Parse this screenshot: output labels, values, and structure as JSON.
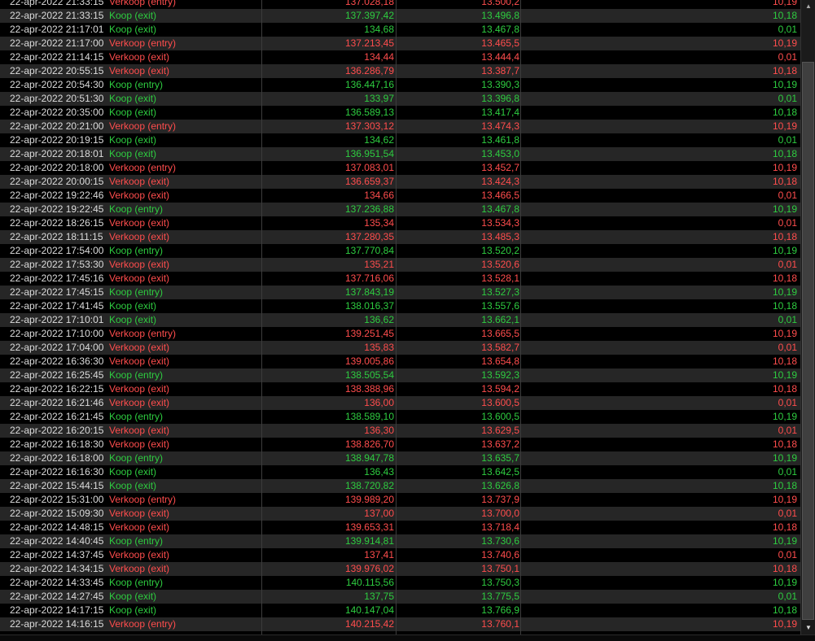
{
  "colors": {
    "buy": "#2ecc40",
    "sell": "#ff4d4d",
    "date": "#dcdcdc"
  },
  "rows": [
    {
      "datetime": "22-apr-2022 21:33:15",
      "type": "Verkoop (entry)",
      "side": "sell",
      "price": "137.028,18",
      "rate": "13.500,2",
      "amount": "10,19"
    },
    {
      "datetime": "22-apr-2022 21:33:15",
      "type": "Koop (exit)",
      "side": "buy",
      "price": "137.397,42",
      "rate": "13.496,8",
      "amount": "10,18"
    },
    {
      "datetime": "22-apr-2022 21:17:01",
      "type": "Koop (exit)",
      "side": "buy",
      "price": "134,68",
      "rate": "13.467,8",
      "amount": "0,01"
    },
    {
      "datetime": "22-apr-2022 21:17:00",
      "type": "Verkoop (entry)",
      "side": "sell",
      "price": "137.213,45",
      "rate": "13.465,5",
      "amount": "10,19"
    },
    {
      "datetime": "22-apr-2022 21:14:15",
      "type": "Verkoop (exit)",
      "side": "sell",
      "price": "134,44",
      "rate": "13.444,4",
      "amount": "0,01"
    },
    {
      "datetime": "22-apr-2022 20:55:15",
      "type": "Verkoop (exit)",
      "side": "sell",
      "price": "136.286,79",
      "rate": "13.387,7",
      "amount": "10,18"
    },
    {
      "datetime": "22-apr-2022 20:54:30",
      "type": "Koop (entry)",
      "side": "buy",
      "price": "136.447,16",
      "rate": "13.390,3",
      "amount": "10,19"
    },
    {
      "datetime": "22-apr-2022 20:51:30",
      "type": "Koop (exit)",
      "side": "buy",
      "price": "133,97",
      "rate": "13.396,8",
      "amount": "0,01"
    },
    {
      "datetime": "22-apr-2022 20:35:00",
      "type": "Koop (exit)",
      "side": "buy",
      "price": "136.589,13",
      "rate": "13.417,4",
      "amount": "10,18"
    },
    {
      "datetime": "22-apr-2022 20:21:00",
      "type": "Verkoop (entry)",
      "side": "sell",
      "price": "137.303,12",
      "rate": "13.474,3",
      "amount": "10,19"
    },
    {
      "datetime": "22-apr-2022 20:19:15",
      "type": "Koop (exit)",
      "side": "buy",
      "price": "134,62",
      "rate": "13.461,8",
      "amount": "0,01"
    },
    {
      "datetime": "22-apr-2022 20:18:01",
      "type": "Koop (exit)",
      "side": "buy",
      "price": "136.951,54",
      "rate": "13.453,0",
      "amount": "10,18"
    },
    {
      "datetime": "22-apr-2022 20:18:00",
      "type": "Verkoop (entry)",
      "side": "sell",
      "price": "137.083,01",
      "rate": "13.452,7",
      "amount": "10,19"
    },
    {
      "datetime": "22-apr-2022 20:00:15",
      "type": "Verkoop (exit)",
      "side": "sell",
      "price": "136.659,37",
      "rate": "13.424,3",
      "amount": "10,18"
    },
    {
      "datetime": "22-apr-2022 19:22:46",
      "type": "Verkoop (exit)",
      "side": "sell",
      "price": "134,66",
      "rate": "13.466,5",
      "amount": "0,01"
    },
    {
      "datetime": "22-apr-2022 19:22:45",
      "type": "Koop (entry)",
      "side": "buy",
      "price": "137.236,88",
      "rate": "13.467,8",
      "amount": "10,19"
    },
    {
      "datetime": "22-apr-2022 18:26:15",
      "type": "Verkoop (exit)",
      "side": "sell",
      "price": "135,34",
      "rate": "13.534,3",
      "amount": "0,01"
    },
    {
      "datetime": "22-apr-2022 18:11:15",
      "type": "Verkoop (exit)",
      "side": "sell",
      "price": "137.280,35",
      "rate": "13.485,3",
      "amount": "10,18"
    },
    {
      "datetime": "22-apr-2022 17:54:00",
      "type": "Koop (entry)",
      "side": "buy",
      "price": "137.770,84",
      "rate": "13.520,2",
      "amount": "10,19"
    },
    {
      "datetime": "22-apr-2022 17:53:30",
      "type": "Verkoop (exit)",
      "side": "sell",
      "price": "135,21",
      "rate": "13.520,6",
      "amount": "0,01"
    },
    {
      "datetime": "22-apr-2022 17:45:16",
      "type": "Verkoop (exit)",
      "side": "sell",
      "price": "137.716,06",
      "rate": "13.528,1",
      "amount": "10,18"
    },
    {
      "datetime": "22-apr-2022 17:45:15",
      "type": "Koop (entry)",
      "side": "buy",
      "price": "137.843,19",
      "rate": "13.527,3",
      "amount": "10,19"
    },
    {
      "datetime": "22-apr-2022 17:41:45",
      "type": "Koop (exit)",
      "side": "buy",
      "price": "138.016,37",
      "rate": "13.557,6",
      "amount": "10,18"
    },
    {
      "datetime": "22-apr-2022 17:10:01",
      "type": "Koop (exit)",
      "side": "buy",
      "price": "136,62",
      "rate": "13.662,1",
      "amount": "0,01"
    },
    {
      "datetime": "22-apr-2022 17:10:00",
      "type": "Verkoop (entry)",
      "side": "sell",
      "price": "139.251,45",
      "rate": "13.665,5",
      "amount": "10,19"
    },
    {
      "datetime": "22-apr-2022 17:04:00",
      "type": "Verkoop (exit)",
      "side": "sell",
      "price": "135,83",
      "rate": "13.582,7",
      "amount": "0,01"
    },
    {
      "datetime": "22-apr-2022 16:36:30",
      "type": "Verkoop (exit)",
      "side": "sell",
      "price": "139.005,86",
      "rate": "13.654,8",
      "amount": "10,18"
    },
    {
      "datetime": "22-apr-2022 16:25:45",
      "type": "Koop (entry)",
      "side": "buy",
      "price": "138.505,54",
      "rate": "13.592,3",
      "amount": "10,19"
    },
    {
      "datetime": "22-apr-2022 16:22:15",
      "type": "Verkoop (exit)",
      "side": "sell",
      "price": "138.388,96",
      "rate": "13.594,2",
      "amount": "10,18"
    },
    {
      "datetime": "22-apr-2022 16:21:46",
      "type": "Verkoop (exit)",
      "side": "sell",
      "price": "136,00",
      "rate": "13.600,5",
      "amount": "0,01"
    },
    {
      "datetime": "22-apr-2022 16:21:45",
      "type": "Koop (entry)",
      "side": "buy",
      "price": "138.589,10",
      "rate": "13.600,5",
      "amount": "10,19"
    },
    {
      "datetime": "22-apr-2022 16:20:15",
      "type": "Verkoop (exit)",
      "side": "sell",
      "price": "136,30",
      "rate": "13.629,5",
      "amount": "0,01"
    },
    {
      "datetime": "22-apr-2022 16:18:30",
      "type": "Verkoop (exit)",
      "side": "sell",
      "price": "138.826,70",
      "rate": "13.637,2",
      "amount": "10,18"
    },
    {
      "datetime": "22-apr-2022 16:18:00",
      "type": "Koop (entry)",
      "side": "buy",
      "price": "138.947,78",
      "rate": "13.635,7",
      "amount": "10,19"
    },
    {
      "datetime": "22-apr-2022 16:16:30",
      "type": "Koop (exit)",
      "side": "buy",
      "price": "136,43",
      "rate": "13.642,5",
      "amount": "0,01"
    },
    {
      "datetime": "22-apr-2022 15:44:15",
      "type": "Koop (exit)",
      "side": "buy",
      "price": "138.720,82",
      "rate": "13.626,8",
      "amount": "10,18"
    },
    {
      "datetime": "22-apr-2022 15:31:00",
      "type": "Verkoop (entry)",
      "side": "sell",
      "price": "139.989,20",
      "rate": "13.737,9",
      "amount": "10,19"
    },
    {
      "datetime": "22-apr-2022 15:09:30",
      "type": "Verkoop (exit)",
      "side": "sell",
      "price": "137,00",
      "rate": "13.700,0",
      "amount": "0,01"
    },
    {
      "datetime": "22-apr-2022 14:48:15",
      "type": "Verkoop (exit)",
      "side": "sell",
      "price": "139.653,31",
      "rate": "13.718,4",
      "amount": "10,18"
    },
    {
      "datetime": "22-apr-2022 14:40:45",
      "type": "Koop (entry)",
      "side": "buy",
      "price": "139.914,81",
      "rate": "13.730,6",
      "amount": "10,19"
    },
    {
      "datetime": "22-apr-2022 14:37:45",
      "type": "Verkoop (exit)",
      "side": "sell",
      "price": "137,41",
      "rate": "13.740,6",
      "amount": "0,01"
    },
    {
      "datetime": "22-apr-2022 14:34:15",
      "type": "Verkoop (exit)",
      "side": "sell",
      "price": "139.976,02",
      "rate": "13.750,1",
      "amount": "10,18"
    },
    {
      "datetime": "22-apr-2022 14:33:45",
      "type": "Koop (entry)",
      "side": "buy",
      "price": "140.115,56",
      "rate": "13.750,3",
      "amount": "10,19"
    },
    {
      "datetime": "22-apr-2022 14:27:45",
      "type": "Koop (exit)",
      "side": "buy",
      "price": "137,75",
      "rate": "13.775,5",
      "amount": "0,01"
    },
    {
      "datetime": "22-apr-2022 14:17:15",
      "type": "Koop (exit)",
      "side": "buy",
      "price": "140.147,04",
      "rate": "13.766,9",
      "amount": "10,18"
    },
    {
      "datetime": "22-apr-2022 14:16:15",
      "type": "Verkoop (entry)",
      "side": "sell",
      "price": "140.215,42",
      "rate": "13.760,1",
      "amount": "10,19"
    }
  ],
  "scrollbar": {
    "up_icon": "triangle-up",
    "down_icon": "triangle-down",
    "position_fraction": 0.97
  }
}
